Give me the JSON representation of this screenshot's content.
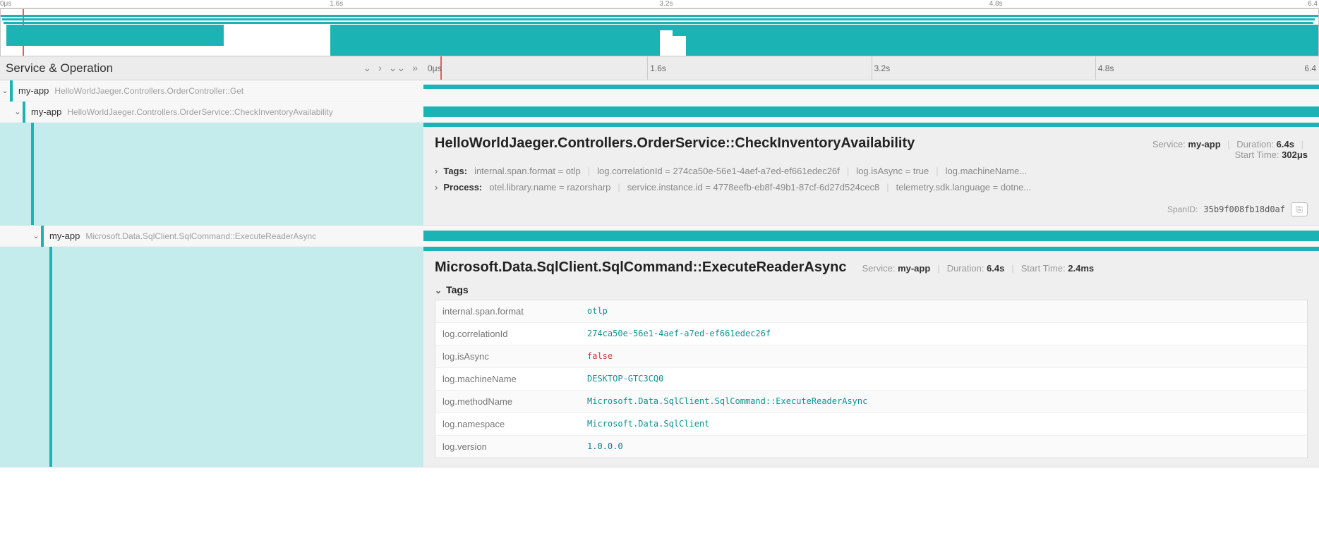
{
  "ruler_top": [
    "0μs",
    "1.6s",
    "3.2s",
    "4.8s",
    "6.4"
  ],
  "ruler_main": [
    "0μs",
    "1.6s",
    "3.2s",
    "4.8s",
    "6.4"
  ],
  "header": {
    "title": "Service & Operation"
  },
  "spans": [
    {
      "svc": "my-app",
      "op": "HelloWorldJaeger.Controllers.OrderController::Get"
    },
    {
      "svc": "my-app",
      "op": "HelloWorldJaeger.Controllers.OrderService::CheckInventoryAvailability"
    },
    {
      "svc": "my-app",
      "op": "Microsoft.Data.SqlClient.SqlCommand::ExecuteReaderAsync"
    }
  ],
  "detail1": {
    "title": "HelloWorldJaeger.Controllers.OrderService::CheckInventoryAvailability",
    "service_label": "Service:",
    "service": "my-app",
    "duration_label": "Duration:",
    "duration": "6.4s",
    "start_label": "Start Time:",
    "start": "302μs",
    "tags_label": "Tags:",
    "tags": [
      {
        "k": "internal.span.format",
        "v": "otlp"
      },
      {
        "k": "log.correlationId",
        "v": "274ca50e-56e1-4aef-a7ed-ef661edec26f"
      },
      {
        "k": "log.isAsync",
        "v": "true"
      },
      {
        "k": "log.machineName...",
        "v": ""
      }
    ],
    "process_label": "Process:",
    "process": [
      {
        "k": "otel.library.name",
        "v": "razorsharp"
      },
      {
        "k": "service.instance.id",
        "v": "4778eefb-eb8f-49b1-87cf-6d27d524cec8"
      },
      {
        "k": "telemetry.sdk.language",
        "v": "dotne..."
      }
    ],
    "spanid_label": "SpanID:",
    "spanid": "35b9f008fb18d0af"
  },
  "detail2": {
    "title": "Microsoft.Data.SqlClient.SqlCommand::ExecuteReaderAsync",
    "service_label": "Service:",
    "service": "my-app",
    "duration_label": "Duration:",
    "duration": "6.4s",
    "start_label": "Start Time:",
    "start": "2.4ms",
    "tags_header": "Tags",
    "tags": [
      {
        "k": "internal.span.format",
        "v": "otlp",
        "cls": "teal"
      },
      {
        "k": "log.correlationId",
        "v": "274ca50e-56e1-4aef-a7ed-ef661edec26f",
        "cls": "teal"
      },
      {
        "k": "log.isAsync",
        "v": "false",
        "cls": "red"
      },
      {
        "k": "log.machineName",
        "v": "DESKTOP-GTC3CQ0",
        "cls": "teal"
      },
      {
        "k": "log.methodName",
        "v": "Microsoft.Data.SqlClient.SqlCommand::ExecuteReaderAsync",
        "cls": "teal"
      },
      {
        "k": "log.namespace",
        "v": "Microsoft.Data.SqlClient",
        "cls": "teal"
      },
      {
        "k": "log.version",
        "v": "1.0.0.0",
        "cls": "blue"
      }
    ]
  }
}
